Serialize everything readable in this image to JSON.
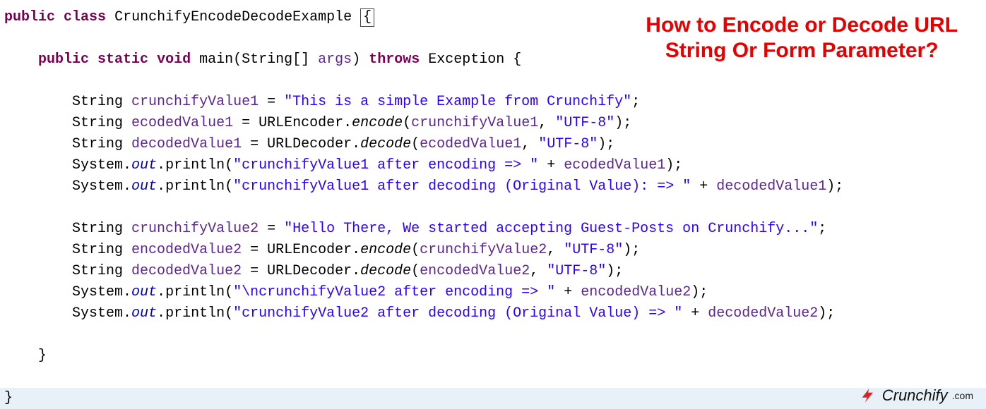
{
  "title_line1": "How to Encode or Decode URL",
  "title_line2": "String Or Form Parameter?",
  "logo_text": "Crunchify",
  "logo_suffix": ".com",
  "logo_color": "#d9252a",
  "code": {
    "kw_public": "public",
    "kw_class": "class",
    "kw_static": "static",
    "kw_void": "void",
    "kw_throws": "throws",
    "class_name": "CrunchifyEncodeDecodeExample",
    "main": "main",
    "string_arr": "String[]",
    "args": "args",
    "exception": "Exception",
    "obrace": "{",
    "cbrace": "}",
    "String": "String",
    "var_crunchifyValue1": "crunchifyValue1",
    "var_ecodedValue1": "ecodedValue1",
    "var_decodedValue1": "decodedValue1",
    "var_crunchifyValue2": "crunchifyValue2",
    "var_encodedValue2": "encodedValue2",
    "var_decodedValue2": "decodedValue2",
    "URLEncoder": "URLEncoder",
    "URLDecoder": "URLDecoder",
    "encode": "encode",
    "decode": "decode",
    "System": "System",
    "out": "out",
    "println": "println",
    "eq": " = ",
    "semi": ";",
    "comma": ", ",
    "dot": ".",
    "plus": " + ",
    "lp": "(",
    "rp": ")",
    "str_utf8": "\"UTF-8\"",
    "str_val1": "\"This is a simple Example from Crunchify\"",
    "str_val2": "\"Hello There, We started accepting Guest-Posts on Crunchify...\"",
    "str_p1": "\"crunchifyValue1 after encoding => \"",
    "str_p2": "\"crunchifyValue1 after decoding (Original Value): => \"",
    "str_p3": "\"\\ncrunchifyValue2 after encoding => \"",
    "str_p4": "\"crunchifyValue2 after decoding (Original Value) => \""
  }
}
